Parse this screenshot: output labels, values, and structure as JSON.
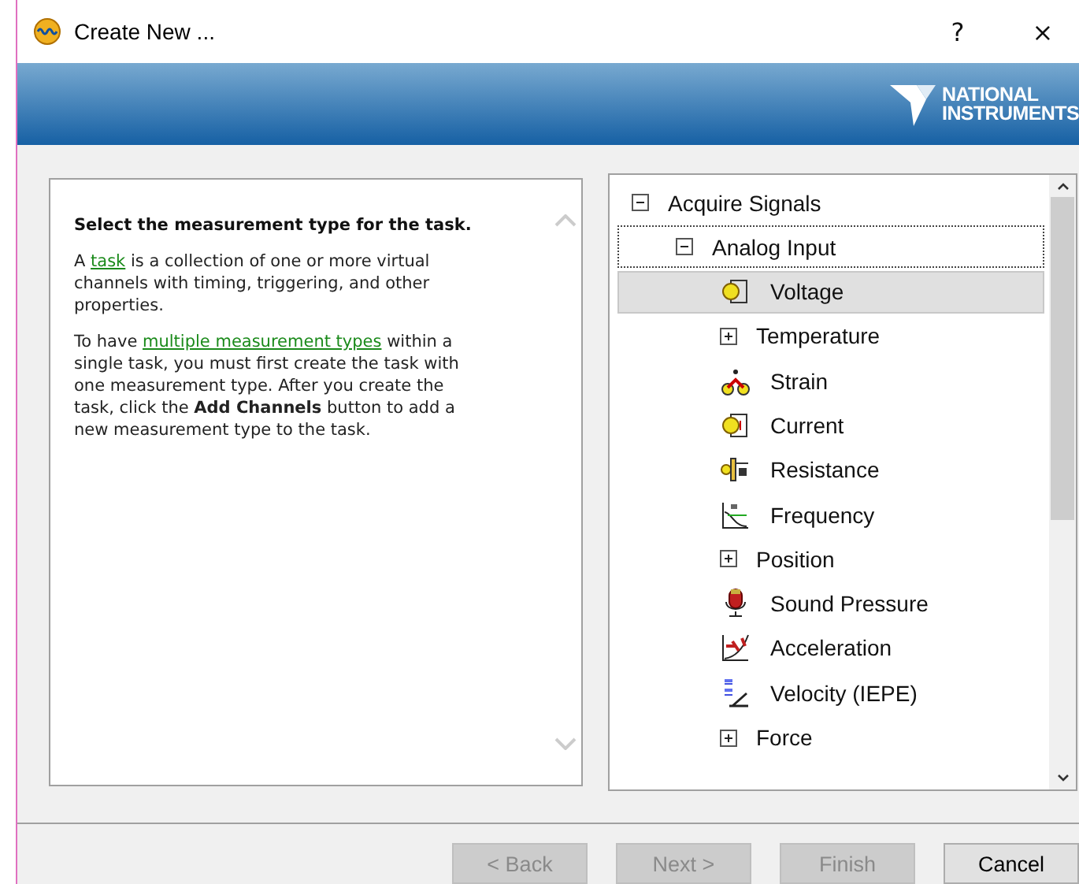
{
  "window": {
    "title": "Create New ...",
    "help": "?",
    "close": "×"
  },
  "banner": {
    "logo_line_1": "NATIONAL",
    "logo_line_2": "INSTRUMENTS"
  },
  "help_panel": {
    "heading": "Select the measurement type for the task.",
    "paragraphs": [
      [
        {
          "kind": "text",
          "text": "A "
        },
        {
          "kind": "link",
          "text": "task"
        },
        {
          "kind": "text",
          "text": " is a collection of one or more virtual channels with timing, triggering, and other properties."
        }
      ],
      [
        {
          "kind": "text",
          "text": "To have "
        },
        {
          "kind": "link",
          "text": "multiple measurement types"
        },
        {
          "kind": "text",
          "text": " within a single task, you must first create the task with one measurement type. After you create the task, click the **Add Channels** button to add a new measurement type to the task."
        }
      ]
    ]
  },
  "tree": [
    {
      "label": "Acquire Signals",
      "expanded": true,
      "selected": false,
      "children": [
        {
          "label": "Analog Input",
          "expanded": true,
          "selected": false,
          "focused": true,
          "children": [
            {
              "label": "Voltage",
              "kind": "voltage",
              "selected": true
            },
            {
              "label": "Temperature",
              "expanded": false,
              "selected": false
            },
            {
              "label": "Strain",
              "kind": "strain",
              "selected": false
            },
            {
              "label": "Current",
              "kind": "current",
              "selected": false
            },
            {
              "label": "Resistance",
              "kind": "resistance",
              "selected": false
            },
            {
              "label": "Frequency",
              "kind": "frequency",
              "selected": false
            },
            {
              "label": "Position",
              "expanded": false,
              "selected": false
            },
            {
              "label": "Sound Pressure",
              "kind": "sound",
              "selected": false
            },
            {
              "label": "Acceleration",
              "kind": "acceleration",
              "selected": false
            },
            {
              "label": "Velocity (IEPE)",
              "kind": "velocity",
              "selected": false
            },
            {
              "label": "Force",
              "expanded": false,
              "selected": false
            }
          ]
        }
      ]
    }
  ],
  "buttons": [
    {
      "label": "< Back",
      "disabled": true
    },
    {
      "label": "Next >",
      "disabled": true
    },
    {
      "label": "Finish",
      "disabled": true
    },
    {
      "label": "Cancel",
      "disabled": false
    }
  ]
}
